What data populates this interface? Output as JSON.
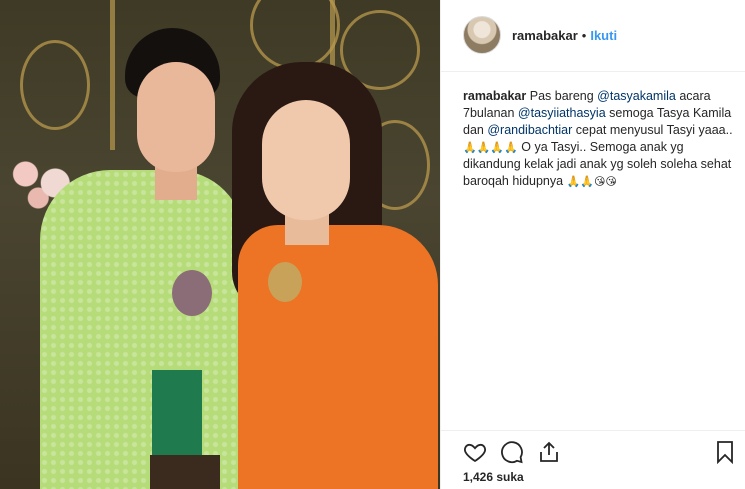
{
  "post": {
    "username": "ramabakar",
    "separator": "•",
    "follow_label": "Ikuti",
    "caption": {
      "username": "ramabakar",
      "t1": "Pas bareng ",
      "m1": "@tasyakamila",
      "t2": " acara 7bulanan ",
      "m2": "@tasyiiathasyia",
      "t3": " semoga Tasya Kamila dan ",
      "m3": "@randibachtiar",
      "t4": " cepat menyusul Tasyi yaaa.. ",
      "e1": "🙏🙏🙏🙏",
      "t5": " O ya Tasyi.. Semoga anak yg dikandung kelak jadi anak yg soleh soleha sehat baroqah hidupnya ",
      "e2": "🙏🙏😘😘"
    },
    "likes": "1,426 suka"
  },
  "icons": {
    "like": "heart-icon",
    "comment": "comment-icon",
    "share": "share-icon",
    "save": "bookmark-icon"
  },
  "colors": {
    "link": "#3897f0",
    "mention": "#003569",
    "text": "#262626",
    "border": "#efefef"
  }
}
